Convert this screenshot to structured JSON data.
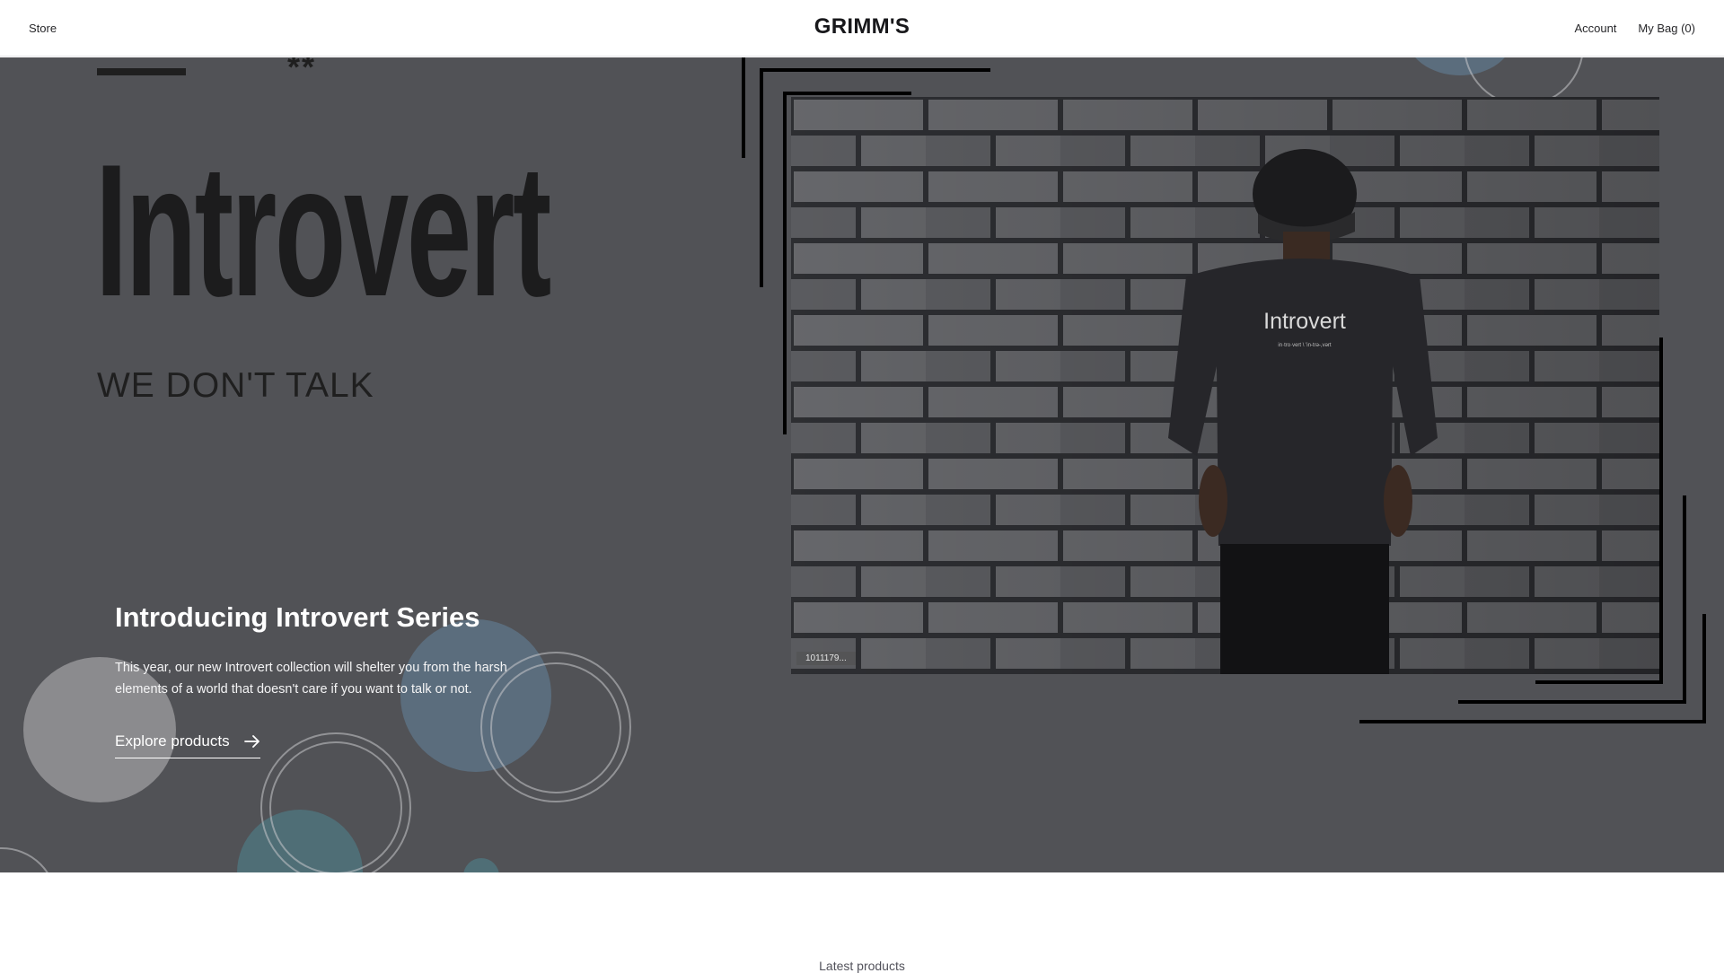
{
  "header": {
    "store_label": "Store",
    "brand": "GRIMM'S",
    "account_label": "Account",
    "bag_label": "My Bag (0)"
  },
  "hero": {
    "stars": "**",
    "title": "Introvert",
    "tagline": "WE DON'T TALK",
    "intro_heading": "Introducing Introvert Series",
    "intro_text": "This year, our new Introvert collection will shelter you from the harsh elements of a world that doesn't care if you want to talk or not.",
    "cta_label": "Explore products",
    "cta_icon": "arrow-right-icon",
    "photo": {
      "shirt_text": "Introvert",
      "shirt_subtext": "in·tro·vert \\ 'in-trə-,vərt",
      "caption": "1011179..."
    }
  },
  "latest": {
    "heading": "Latest products"
  },
  "colors": {
    "hero_bg": "#515256",
    "title_color": "#1c1c1d",
    "accent_blue": "#5f7a92",
    "text_white": "#ffffff"
  }
}
